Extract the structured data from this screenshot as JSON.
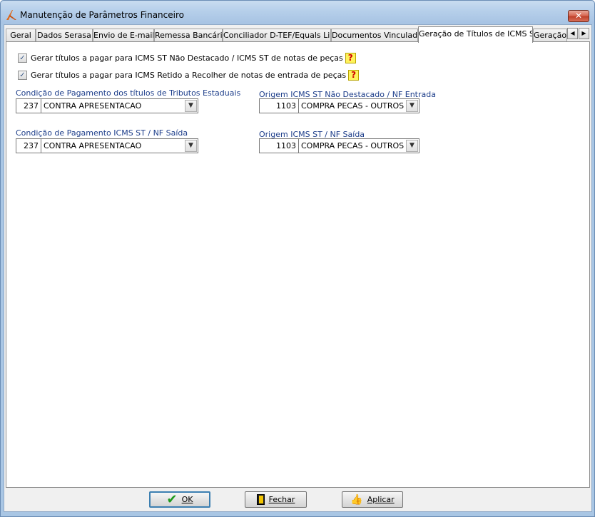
{
  "window": {
    "title": "Manutenção de Parâmetros Financeiro",
    "close_symbol": "✕"
  },
  "tabs": [
    {
      "label": "Geral",
      "active": false
    },
    {
      "label": "Dados Serasa",
      "active": false
    },
    {
      "label": "Envio de E-mail",
      "active": false
    },
    {
      "label": "Remessa Bancária",
      "active": false
    },
    {
      "label": "Conciliador D-TEF/Equals Lite",
      "active": false
    },
    {
      "label": "Documentos Vinculados",
      "active": false
    },
    {
      "label": "Geração de Títulos de ICMS ST",
      "active": true
    },
    {
      "label": "Geração",
      "active": false
    }
  ],
  "tab_scroll": {
    "left": "◀",
    "right": "▶"
  },
  "checkboxes": [
    {
      "label": "Gerar títulos a pagar para ICMS ST Não Destacado / ICMS ST de notas de peças",
      "checked": true,
      "help": "?"
    },
    {
      "label": "Gerar títulos a pagar para ICMS Retido a Recolher de notas de entrada de peças",
      "checked": true,
      "help": "?"
    }
  ],
  "fields": {
    "cond_tributos": {
      "label": "Condição de Pagamento dos títulos de Tributos Estaduais",
      "code": "237",
      "value": "CONTRA APRESENTACAO"
    },
    "cond_icms_saida": {
      "label": "Condição de Pagamento ICMS ST / NF Saída",
      "code": "237",
      "value": "CONTRA APRESENTACAO"
    },
    "origem_entrada": {
      "label": "Origem ICMS ST Não Destacado / NF Entrada",
      "code": "1103",
      "value": "COMPRA PECAS - OUTROS"
    },
    "origem_saida": {
      "label": "Origem ICMS ST / NF Saída",
      "code": "1103",
      "value": "COMPRA PECAS - OUTROS"
    }
  },
  "buttons": {
    "ok": {
      "label": "OK",
      "icon": "check-icon"
    },
    "fechar": {
      "label": "Fechar",
      "icon": "exit-door-icon"
    },
    "aplicar": {
      "label": "Aplicar",
      "icon": "thumbs-up-icon"
    }
  },
  "colors": {
    "label_blue": "#1c3d8a",
    "title_bar": "#b6cfea",
    "help_yellow": "#fff35c"
  }
}
